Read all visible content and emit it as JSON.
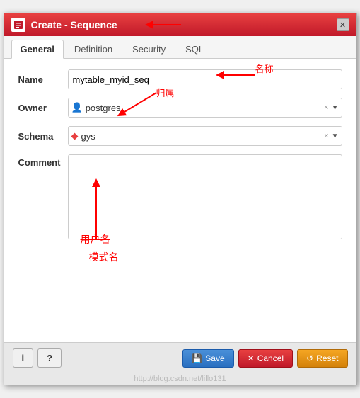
{
  "dialog": {
    "title": "Create - Sequence",
    "close_label": "✕"
  },
  "tabs": {
    "items": [
      {
        "id": "general",
        "label": "General",
        "active": true
      },
      {
        "id": "definition",
        "label": "Definition",
        "active": false
      },
      {
        "id": "security",
        "label": "Security",
        "active": false
      },
      {
        "id": "sql",
        "label": "SQL",
        "active": false
      }
    ]
  },
  "form": {
    "name_label": "Name",
    "name_value": "mytable_myid_seq",
    "name_placeholder": "",
    "owner_label": "Owner",
    "owner_value": "postgres",
    "owner_icon": "👤",
    "schema_label": "Schema",
    "schema_value": "gys",
    "schema_icon": "◆",
    "comment_label": "Comment",
    "comment_value": ""
  },
  "annotations": {
    "name_label": "名称",
    "owner_label": "归属",
    "schema_name_label": "模式名",
    "user_name_label": "用户名"
  },
  "footer": {
    "info_label": "i",
    "help_label": "?",
    "save_label": "Save",
    "cancel_label": "Cancel",
    "reset_label": "Reset",
    "watermark": "http://blog.csdn.net/lillo131"
  }
}
